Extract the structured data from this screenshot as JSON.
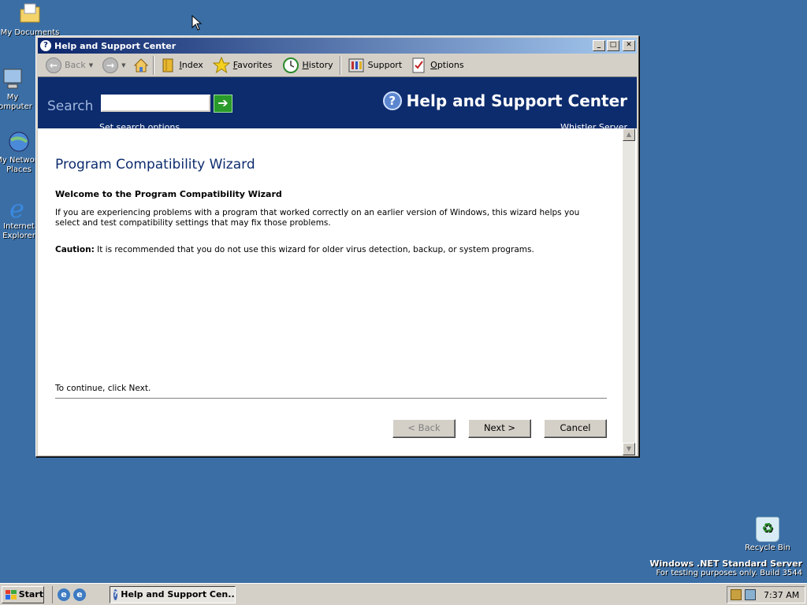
{
  "desktop": {
    "icons": [
      {
        "label": "My Documents"
      },
      {
        "label": "My Computer"
      },
      {
        "label": "My Network Places"
      },
      {
        "label": "Internet Explorer"
      }
    ],
    "recycle_bin": "Recycle Bin",
    "brand_line1": "Windows .NET Standard Server",
    "brand_line2": "For testing purposes only. Build 3544"
  },
  "window": {
    "title": "Help and Support Center",
    "controls": {
      "minimize": "_",
      "maximize": "□",
      "close": "✕"
    }
  },
  "toolbar": {
    "back": "Back",
    "index": "Index",
    "favorites": "Favorites",
    "history": "History",
    "support": "Support",
    "options": "Options"
  },
  "header": {
    "search_label": "Search",
    "search_value": "",
    "set_options": "Set search options",
    "title": "Help and Support Center",
    "subtitle": "Whistler Server"
  },
  "wizard": {
    "title": "Program Compatibility Wizard",
    "welcome": "Welcome to the Program Compatibility Wizard",
    "description": "If you are experiencing problems with a program that worked correctly on an earlier version of Windows, this wizard helps you select and test compatibility settings that may fix those problems.",
    "caution_label": "Caution:",
    "caution_text": " It is recommended that you do not use this wizard for older virus detection, backup, or system programs.",
    "continue": "To continue, click Next.",
    "back_button": "< Back",
    "next_button": "Next >",
    "cancel_button": "Cancel"
  },
  "taskbar": {
    "start": "Start",
    "task": "Help and Support Cen...",
    "clock": "7:37 AM"
  },
  "colors": {
    "desktop": "#3a6ea5",
    "header": "#0d2c6e",
    "title_gradient_start": "#0a246a"
  }
}
